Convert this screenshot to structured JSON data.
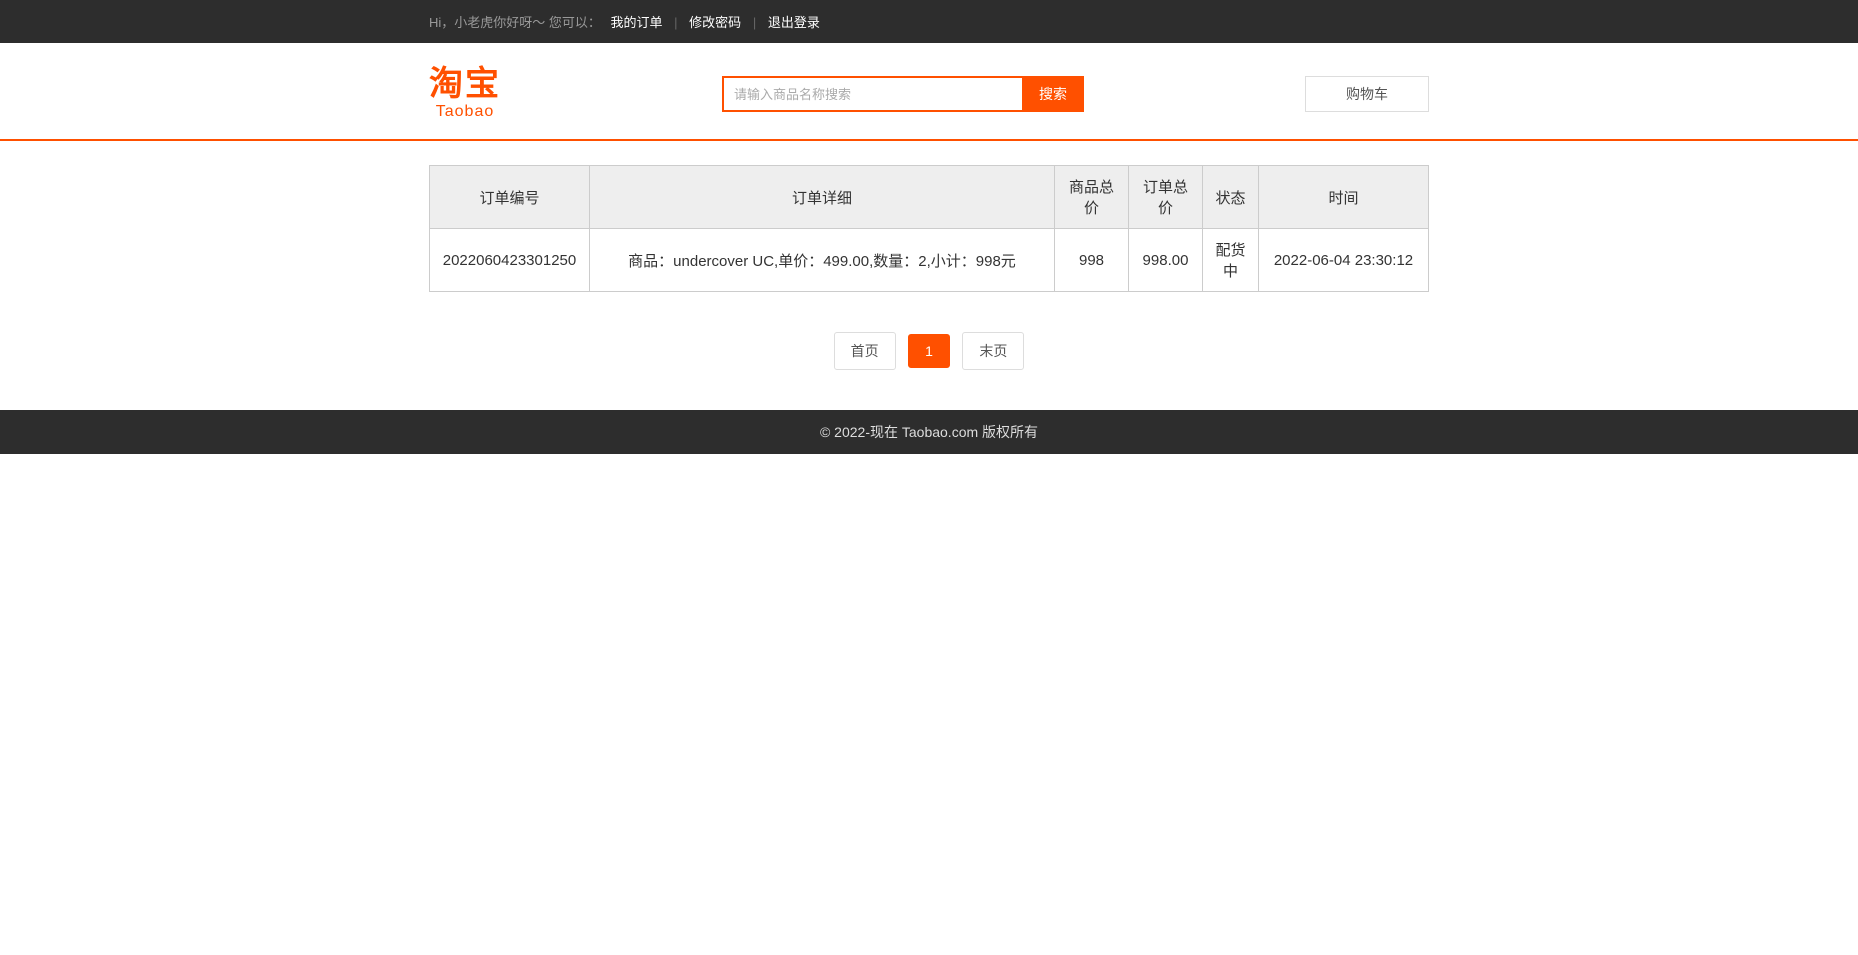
{
  "topbar": {
    "greeting": "Hi，小老虎你好呀～ 您可以：",
    "my_orders": "我的订单",
    "change_password": "修改密码",
    "logout": "退出登录"
  },
  "logo": {
    "cn": "淘宝",
    "en": "Taobao"
  },
  "search": {
    "placeholder": "请输入商品名称搜索",
    "button": "搜索"
  },
  "cart": {
    "label": "购物车"
  },
  "table": {
    "headers": {
      "order_no": "订单编号",
      "order_detail": "订单详细",
      "goods_total": "商品总价",
      "order_total": "订单总价",
      "status": "状态",
      "time": "时间"
    },
    "rows": [
      {
        "order_no": "2022060423301250",
        "order_detail": "商品：undercover UC,单价：499.00,数量：2,小计：998元",
        "goods_total": "998",
        "order_total": "998.00",
        "status": "配货中",
        "time": "2022-06-04 23:30:12"
      }
    ]
  },
  "pagination": {
    "first": "首页",
    "page1": "1",
    "last": "末页"
  },
  "footer": {
    "text": "© 2022-现在 Taobao.com 版权所有"
  }
}
